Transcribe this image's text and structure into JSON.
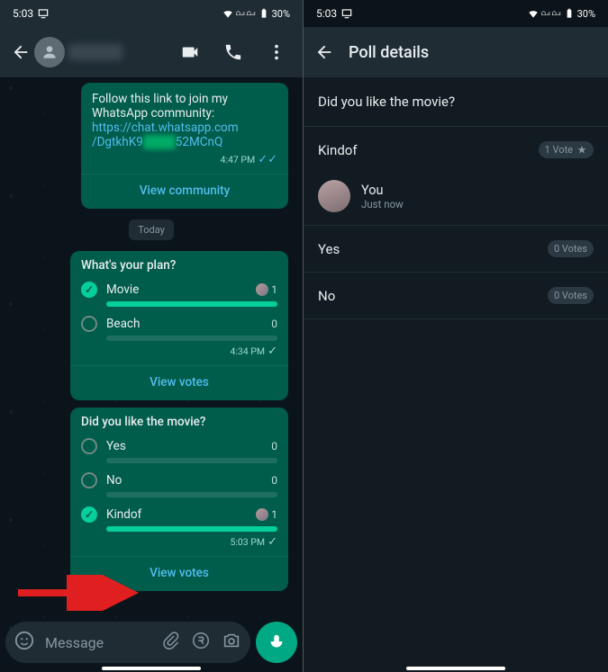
{
  "left": {
    "status": {
      "time": "5:03",
      "battery": "30%"
    },
    "community": {
      "invite": "Follow this link to join my WhatsApp community:",
      "url1": "https://chat.whatsapp.com",
      "url2_l": "/DgtkhK9",
      "url2_r": "52MCnQ",
      "ts": "4:47 PM",
      "action": "View community"
    },
    "date": "Today",
    "poll1": {
      "question": "What's your plan?",
      "opt1": {
        "label": "Movie",
        "count": "1",
        "pct": 100,
        "checked": true
      },
      "opt2": {
        "label": "Beach",
        "count": "0",
        "pct": 0,
        "checked": false
      },
      "ts": "4:34 PM",
      "action": "View votes"
    },
    "poll2": {
      "question": "Did you like the movie?",
      "opt1": {
        "label": "Yes",
        "count": "0",
        "pct": 0
      },
      "opt2": {
        "label": "No",
        "count": "0",
        "pct": 0
      },
      "opt3": {
        "label": "Kindof",
        "count": "1",
        "pct": 100,
        "checked": true
      },
      "ts": "5:03 PM",
      "action": "View votes"
    },
    "input": {
      "placeholder": "Message"
    }
  },
  "right": {
    "status": {
      "time": "5:03",
      "battery": "30%"
    },
    "title": "Poll details",
    "question": "Did you like the movie?",
    "ans1": {
      "label": "Kindof",
      "votes": "1 Vote"
    },
    "voter": {
      "name": "You",
      "when": "Just now"
    },
    "ans2": {
      "label": "Yes",
      "votes": "0 Votes"
    },
    "ans3": {
      "label": "No",
      "votes": "0 Votes"
    }
  }
}
